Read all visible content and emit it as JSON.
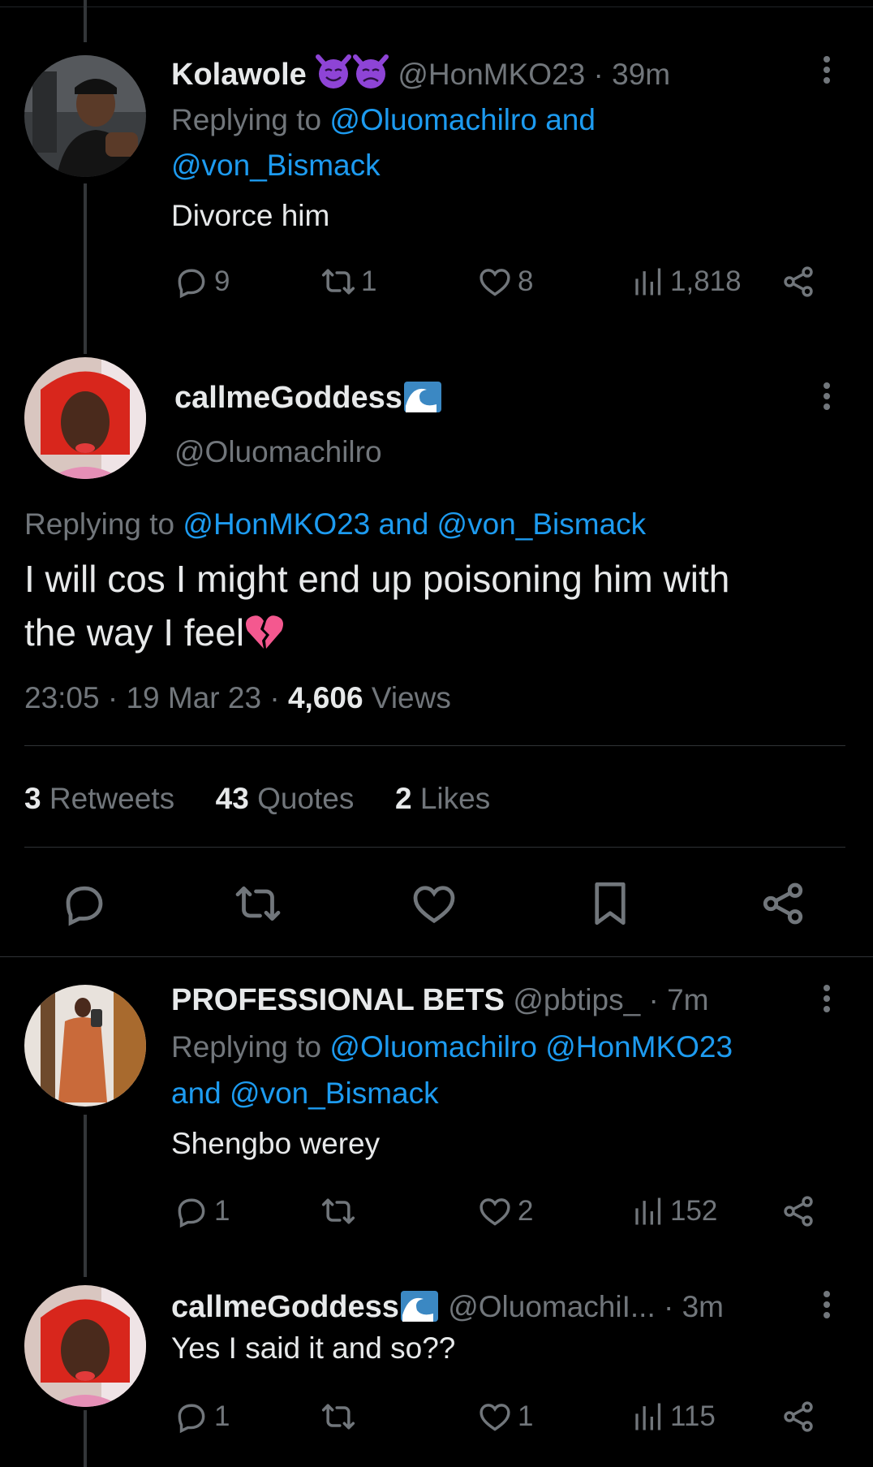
{
  "tweet1": {
    "name": "Kolawole",
    "handle": "@HonMKO23",
    "time": "· 39m",
    "replying_prefix": "Replying to",
    "replying_to_line1": "@Oluomachilro and",
    "replying_to_line2": "@von_Bismack",
    "text": "Divorce him",
    "replies": "9",
    "retweets": "1",
    "likes": "8",
    "views": "1,818"
  },
  "main": {
    "name": "callmeGoddess",
    "handle": "@Oluomachilro",
    "replying_prefix": "Replying to",
    "replying_to": "@HonMKO23 and @von_Bismack",
    "text_line1": "I will cos I might end up poisoning him with",
    "text_line2": "the way I feel",
    "timestamp": "23:05 · 19 Mar 23 ·",
    "views_count": "4,606",
    "views_label": "Views",
    "retweets_count": "3",
    "retweets_label": "Retweets",
    "quotes_count": "43",
    "quotes_label": "Quotes",
    "likes_count": "2",
    "likes_label": "Likes"
  },
  "tweet3": {
    "name": "PROFESSIONAL BETS",
    "handle": "@pbtips_",
    "time": "· 7m",
    "replying_prefix": "Replying to",
    "replying_to_line1": "@Oluomachilro @HonMKO23",
    "replying_to_line2": "and @von_Bismack",
    "text": "Shengbo werey",
    "replies": "1",
    "retweets": "",
    "likes": "2",
    "views": "152"
  },
  "tweet4": {
    "name": "callmeGoddess",
    "handle": "@OluomachiI...",
    "time": "· 3m",
    "text": "Yes I said it and so??",
    "replies": "1",
    "retweets": "",
    "likes": "1",
    "views": "115"
  },
  "colors": {
    "background": "#000000",
    "text": "#e7e9ea",
    "muted": "#71767b",
    "link": "#1d9bf0",
    "divider": "#2f3336"
  },
  "icons": [
    "reply-icon",
    "retweet-icon",
    "like-icon",
    "views-icon",
    "share-icon",
    "bookmark-icon",
    "more-icon",
    "smiling-devil-emoji",
    "angry-devil-emoji",
    "wave-emoji",
    "broken-heart-emoji"
  ]
}
